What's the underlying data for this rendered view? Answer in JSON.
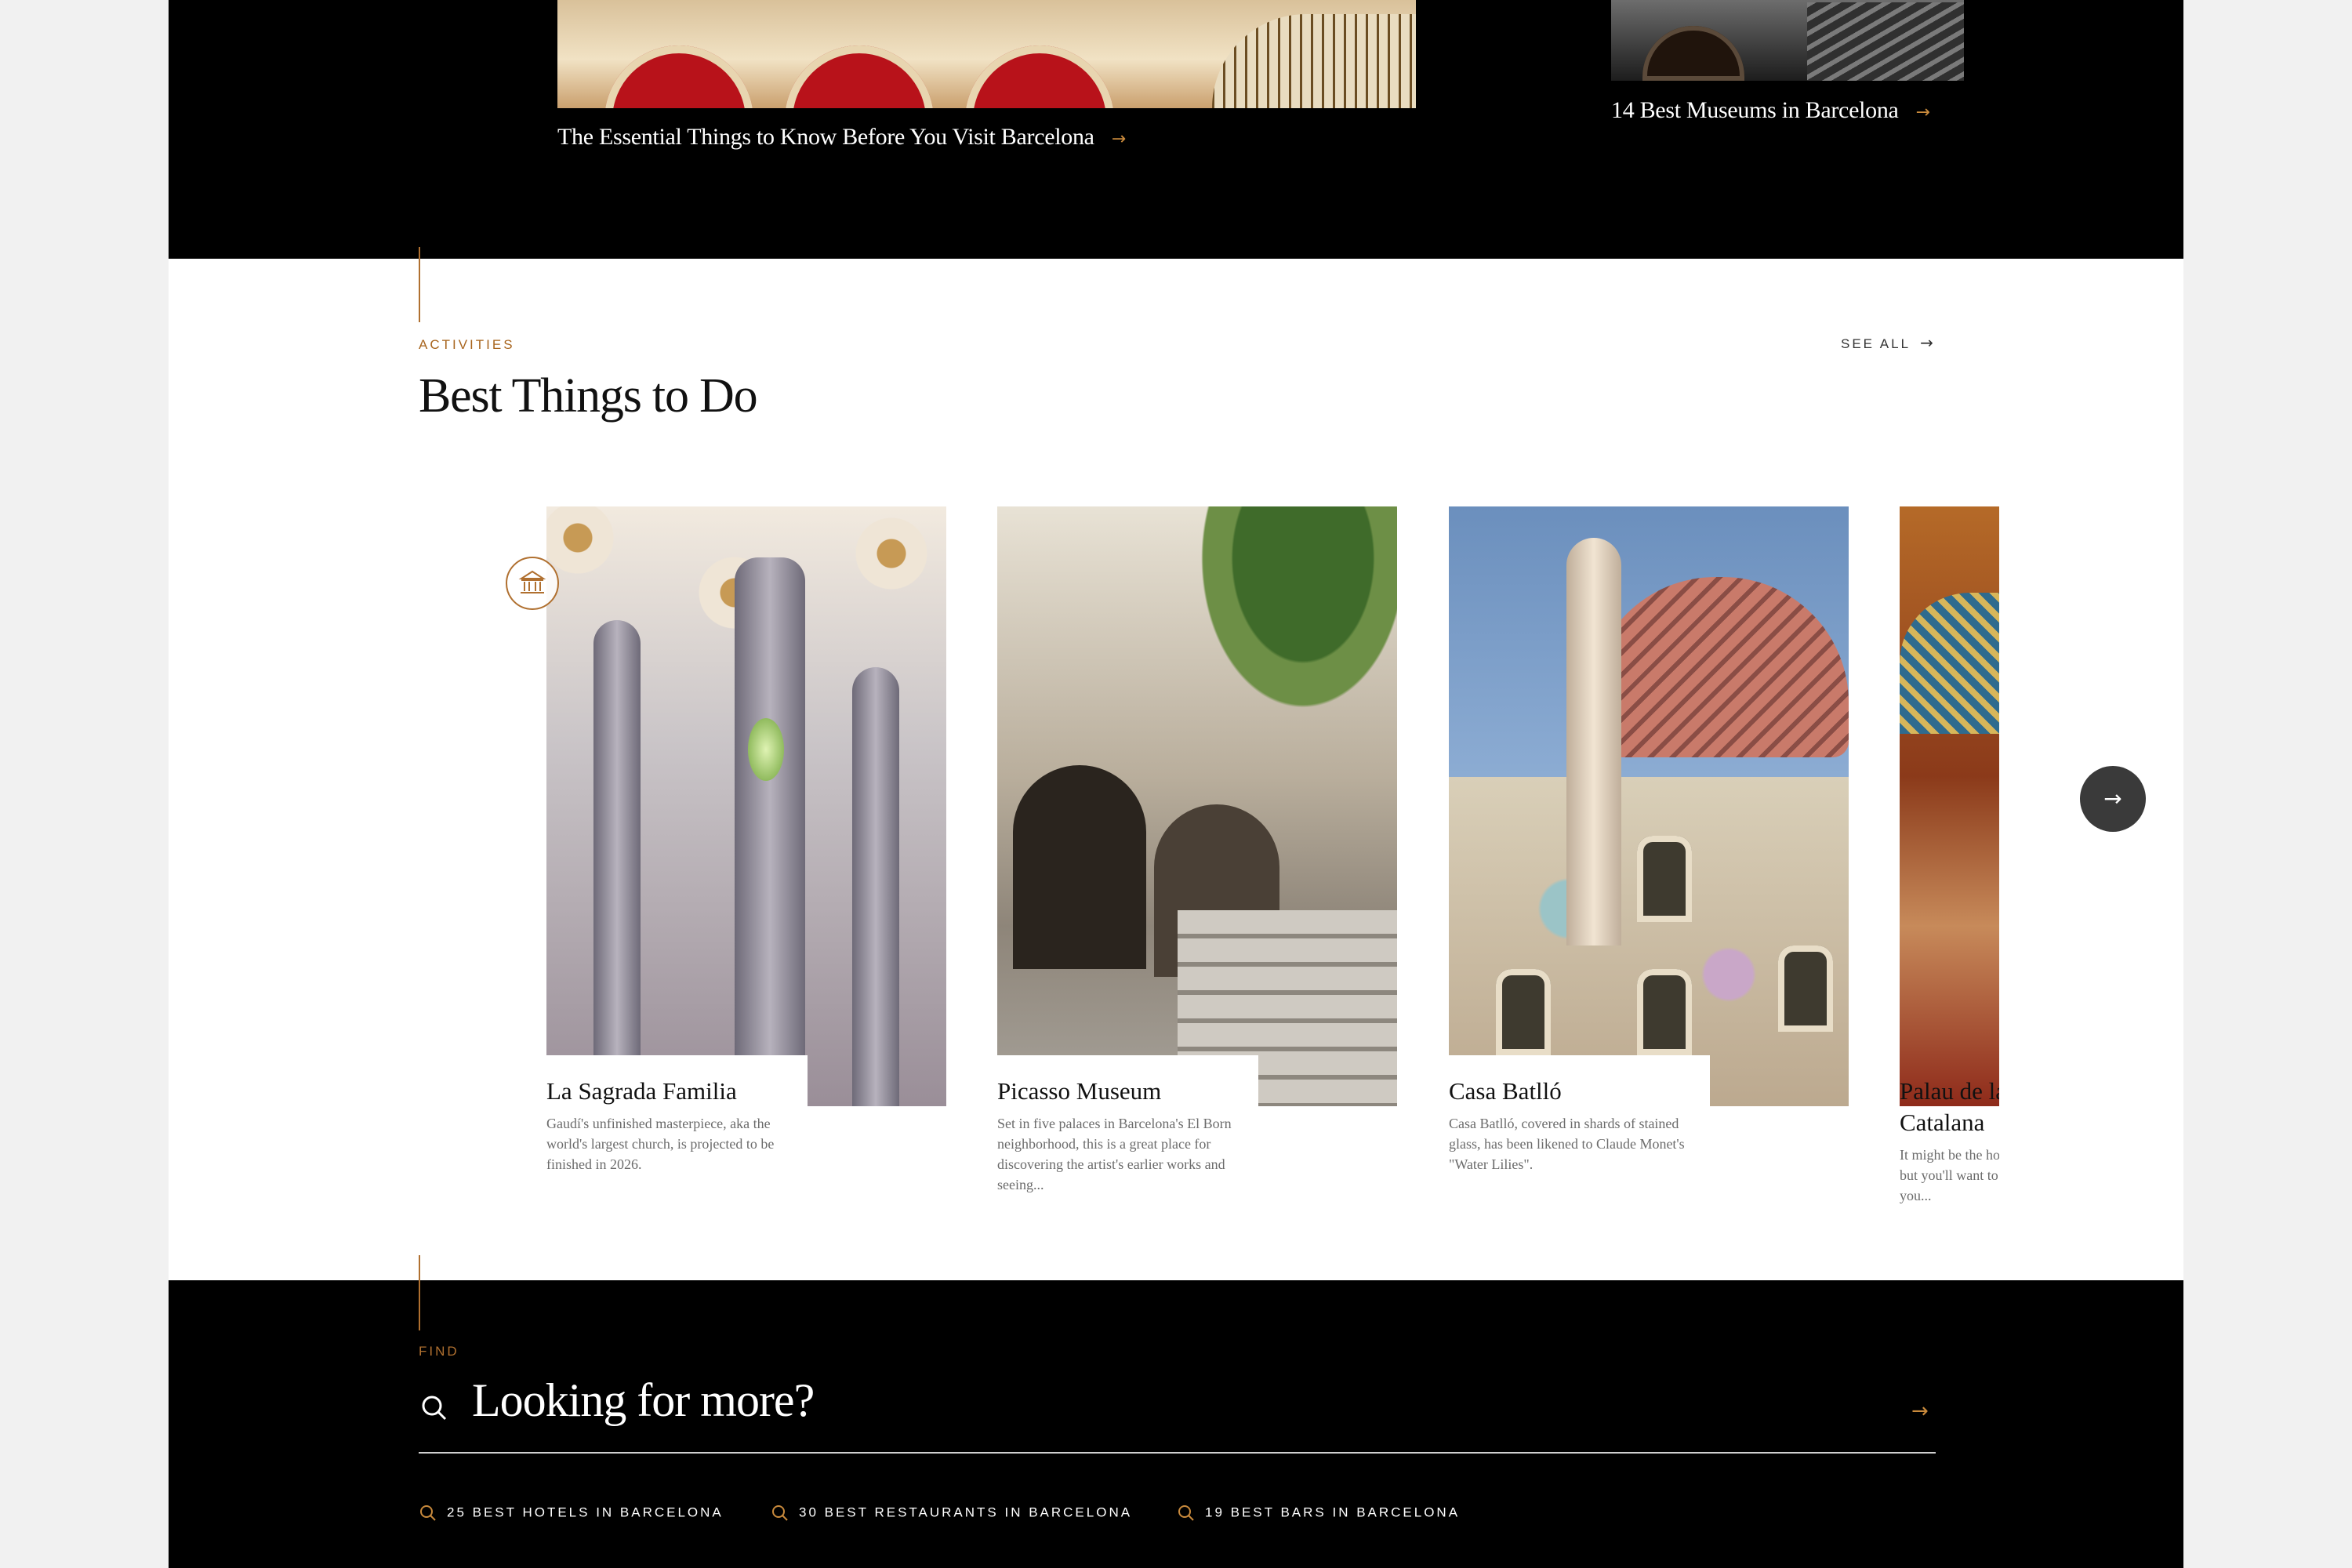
{
  "top_articles": [
    {
      "title": "The Essential Things to Know Before You Visit Barcelona",
      "arrow": "→"
    },
    {
      "title": "14 Best Museums in Barcelona",
      "arrow": "→"
    }
  ],
  "activities": {
    "eyebrow": "ACTIVITIES",
    "title": "Best Things to Do",
    "see_all": "SEE ALL",
    "see_all_arrow": "→",
    "next_arrow": "→",
    "cards": [
      {
        "name": "La Sagrada Familia",
        "desc": "Gaudí's unfinished masterpiece, aka the world's largest church, is projected to be finished in 2026.",
        "icon": "museum-icon"
      },
      {
        "name": "Picasso Museum",
        "desc": "Set in five palaces in Barcelona's El Born neighborhood, this is a great place for discovering the artist's earlier works and seeing..."
      },
      {
        "name": "Casa Batlló",
        "desc": "Casa Batlló, covered in shards of stained glass, has been likened to Claude Monet's \"Water Lilies\"."
      },
      {
        "name": "Palau de la Música Catalana",
        "desc": "It might be the home of Catalan Music, but you'll want to feast your eyes as you..."
      }
    ]
  },
  "find": {
    "eyebrow": "FIND",
    "search_label": "Looking for more?",
    "arrow": "→",
    "quick_links": [
      "25 BEST HOTELS IN BARCELONA",
      "30 BEST RESTAURANTS IN BARCELONA",
      "19 BEST BARS IN BARCELONA"
    ]
  },
  "colors": {
    "accent": "#b07030",
    "band": "#000000",
    "gray_text": "#6b6b6b"
  }
}
